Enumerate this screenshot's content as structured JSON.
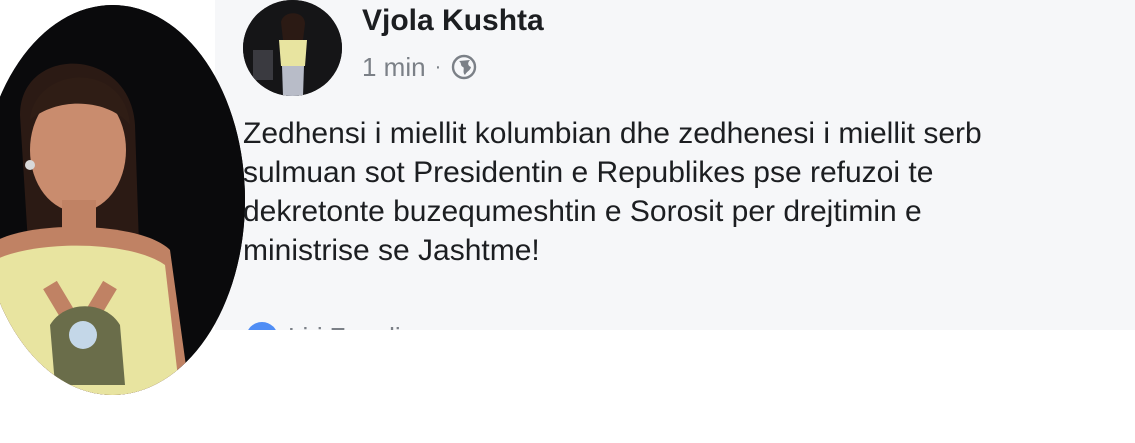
{
  "post": {
    "author": "Vjola Kushta",
    "time": "1 min",
    "separator": "·",
    "privacy_icon": "globe-icon",
    "text": "Zedhensi i miellit kolumbian dhe zedhenesi i miellit serb\nsulmuan sot Presidentin e Republikes pse refuzoi te\ndekretonte buzequmeshtin e Sorosit per drejtimin e\nministrise se Jashtme!",
    "reactions_partial": "Liri Zeneli"
  },
  "colors": {
    "card_background": "#f6f7f9",
    "text": "#1c1e21",
    "meta": "#7b8087",
    "like_blue": "#4f8df5"
  }
}
